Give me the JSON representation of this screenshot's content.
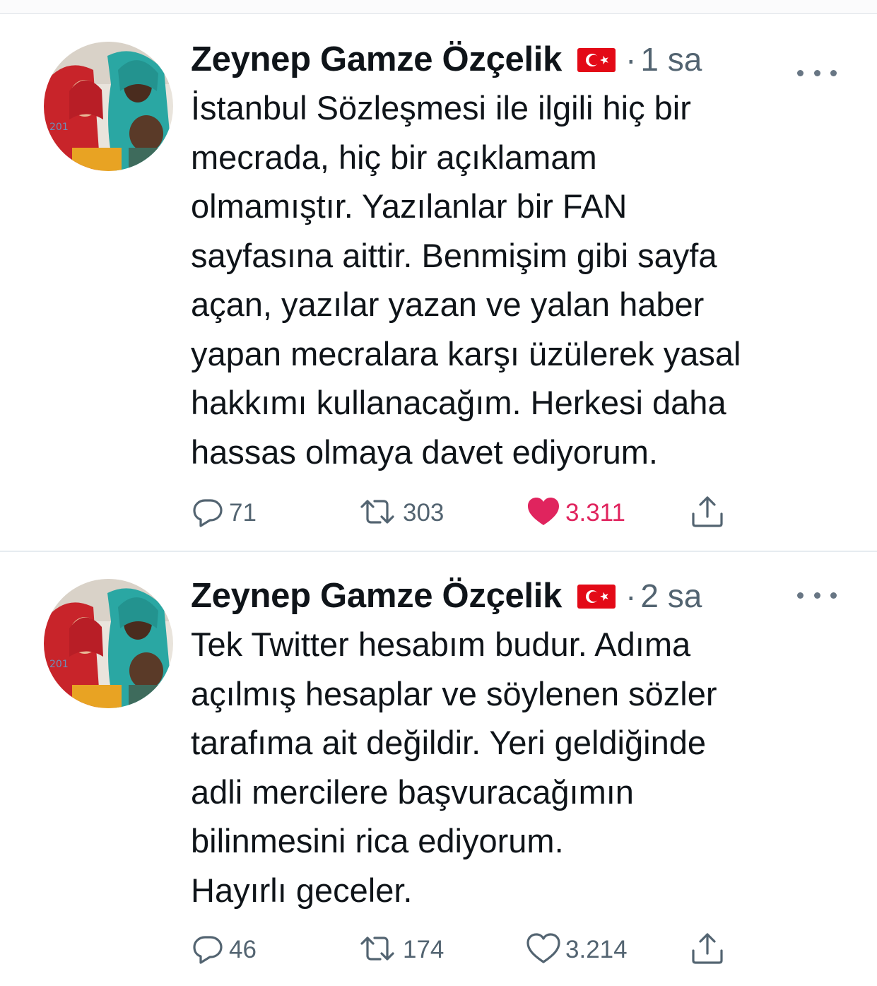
{
  "tweets": [
    {
      "author": "Zeynep Gamze Özçelik",
      "flag_icon": "turkey-flag-icon",
      "separator": "·",
      "time": "1 sa",
      "text": "İstanbul Sözleşmesi ile ilgili hiç bir\nmecrada, hiç bir açıklamam\nolmamıştır. Yazılanlar bir FAN\nsayfasına aittir. Benmişim gibi sayfa\naçan, yazılar yazan ve yalan haber\nyapan mecralara karşı üzülerek yasal\nhakkımı kullanacağım. Herkesi daha\nhassas olmaya davet ediyorum.",
      "replies": "71",
      "retweets": "303",
      "likes": "3.311",
      "liked": true
    },
    {
      "author": "Zeynep Gamze Özçelik",
      "flag_icon": "turkey-flag-icon",
      "separator": "·",
      "time": "2 sa",
      "text": "Tek Twitter hesabım budur. Adıma\naçılmış hesaplar ve söylenen sözler\ntarafıma ait değildir. Yeri geldiğinde\nadli mercilere başvuracağımın\nbilinmesini rica ediyorum.\nHayırlı geceler.",
      "replies": "46",
      "retweets": "174",
      "likes": "3.214",
      "liked": false
    }
  ],
  "colors": {
    "text_primary": "#0f1419",
    "text_secondary": "#536471",
    "like_active": "#e0245e",
    "divider": "#e6ecf0"
  }
}
